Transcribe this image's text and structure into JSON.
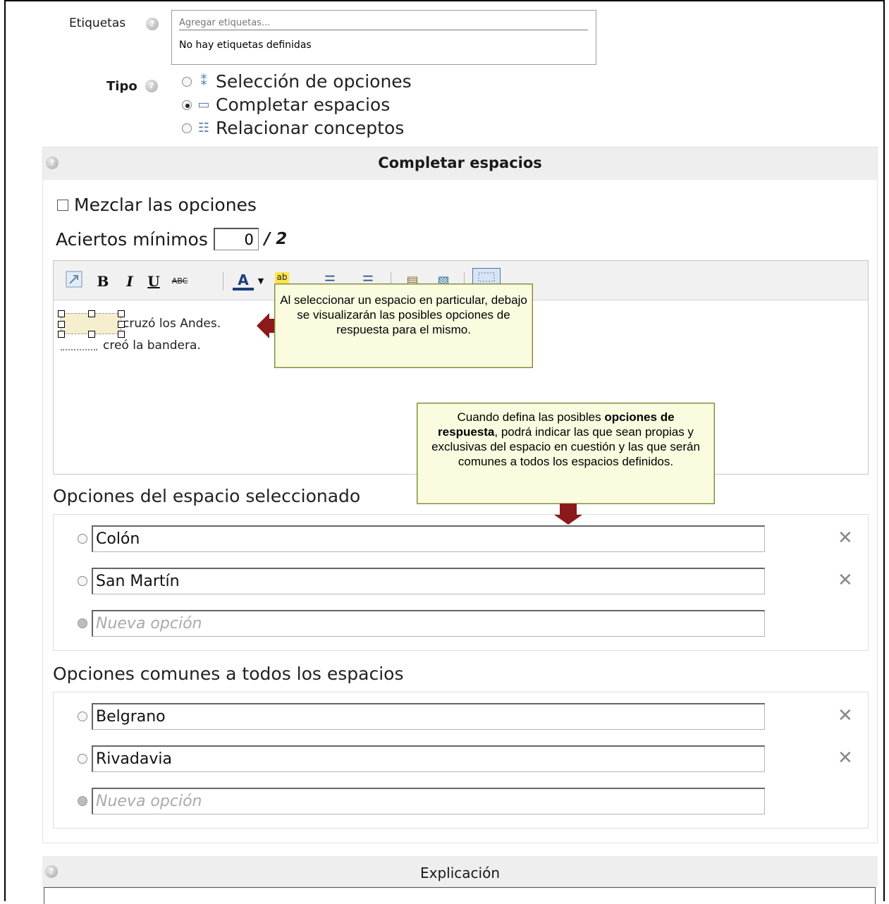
{
  "tags": {
    "label": "Etiquetas",
    "placeholder": "Agregar etiquetas...",
    "empty_text": "No hay etiquetas definidas"
  },
  "tipo": {
    "label": "Tipo",
    "options": [
      {
        "label": "Selección de opciones",
        "selected": false,
        "icon": "choice-icon"
      },
      {
        "label": "Completar espacios",
        "selected": true,
        "icon": "blank-field-icon"
      },
      {
        "label": "Relacionar conceptos",
        "selected": false,
        "icon": "match-list-icon"
      }
    ]
  },
  "section": {
    "title": "Completar espacios",
    "mix_label": "Mezclar las opciones",
    "aciertos_label": "Aciertos mínimos",
    "aciertos_value": "0",
    "aciertos_total": "/ 2"
  },
  "editor": {
    "line1": "cruzó los Andes.",
    "line2": "creó la bandera."
  },
  "callouts": {
    "top": "Al seleccionar un espacio en particular, debajo se visualizarán las posibles opciones de respuesta para el mismo.",
    "bottom_pre": "Cuando defina las posibles ",
    "bottom_bold": "opciones de respuesta",
    "bottom_post": ", podrá indicar las que sean propias y exclusivas del espacio en cuestión y las que serán comunes a todos los espacios definidos."
  },
  "space_options": {
    "title": "Opciones del espacio seleccionado",
    "items": [
      "Colón",
      "San Martín"
    ],
    "new_placeholder": "Nueva opción"
  },
  "common_options": {
    "title": "Opciones comunes a todos los espacios",
    "items": [
      "Belgrano",
      "Rivadavia"
    ],
    "new_placeholder": "Nueva opción"
  },
  "explicacion": {
    "title": "Explicación"
  },
  "colors": {
    "header_bg": "#eeeeee",
    "callout_bg": "#fbfbe0",
    "arrow": "#8b1a1a"
  }
}
